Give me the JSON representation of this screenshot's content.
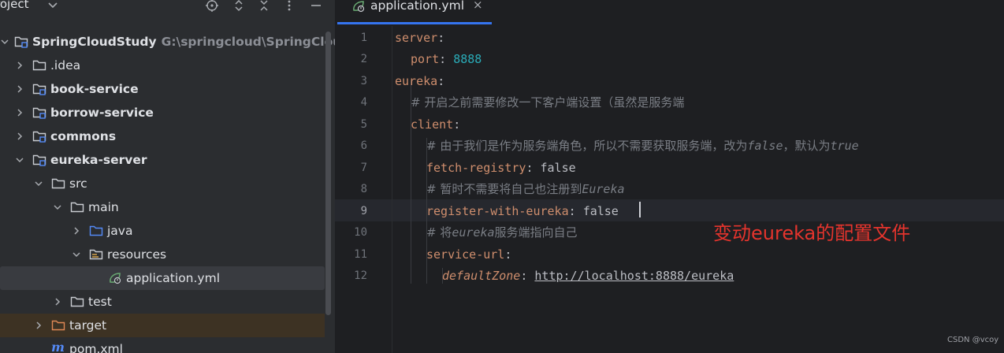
{
  "project": {
    "title": "roject",
    "tree": [
      {
        "label": "SpringCloudStudy",
        "path": "G:\\springcloud\\SpringCloudSt",
        "bold": true
      },
      {
        "label": ".idea"
      },
      {
        "label": "book-service",
        "bold": true
      },
      {
        "label": "borrow-service",
        "bold": true
      },
      {
        "label": "commons",
        "bold": true
      },
      {
        "label": "eureka-server",
        "bold": true
      },
      {
        "label": "src"
      },
      {
        "label": "main"
      },
      {
        "label": "java"
      },
      {
        "label": "resources"
      },
      {
        "label": "application.yml",
        "selected": true
      },
      {
        "label": "test"
      },
      {
        "label": "target"
      },
      {
        "label": "pom.xml"
      }
    ]
  },
  "editor": {
    "tab": {
      "label": "application.yml",
      "close": "×"
    },
    "lines": [
      "1",
      "2",
      "3",
      "4",
      "5",
      "6",
      "7",
      "8",
      "9",
      "10",
      "11",
      "12"
    ],
    "active_line": "9",
    "code": {
      "l1_key": "server",
      "l2_key": "port",
      "l2_val": "8888",
      "l3_key": "eureka",
      "l4_comment": "# 开启之前需要修改一下客户端设置（虽然是服务端",
      "l5_key": "client",
      "l6_comment_a": "# 由于我们是作为服务端角色，所以不需要获取服务端，改为",
      "l6_false": "false",
      "l6_comment_b": "，默认为",
      "l6_true": "true",
      "l7_key": "fetch-registry",
      "l7_val": "false",
      "l8_comment_a": "# 暂时不需要将自己也注册到",
      "l8_eureka": "Eureka",
      "l9_key": "register-with-eureka",
      "l9_val": "false",
      "l10_comment_a": "# 将",
      "l10_eureka": "eureka",
      "l10_comment_b": "服务端指向自己",
      "l11_key": "service-url",
      "l12_key": "defaultZone",
      "l12_val": "http://localhost:8888/eureka"
    },
    "annotation": "变动eureka的配置文件"
  },
  "watermark": "CSDN @vcoy",
  "colors": {
    "accent": "#3574f0",
    "annotation": "#e5342d",
    "key": "#cf8e6d",
    "number": "#2aacb8"
  }
}
